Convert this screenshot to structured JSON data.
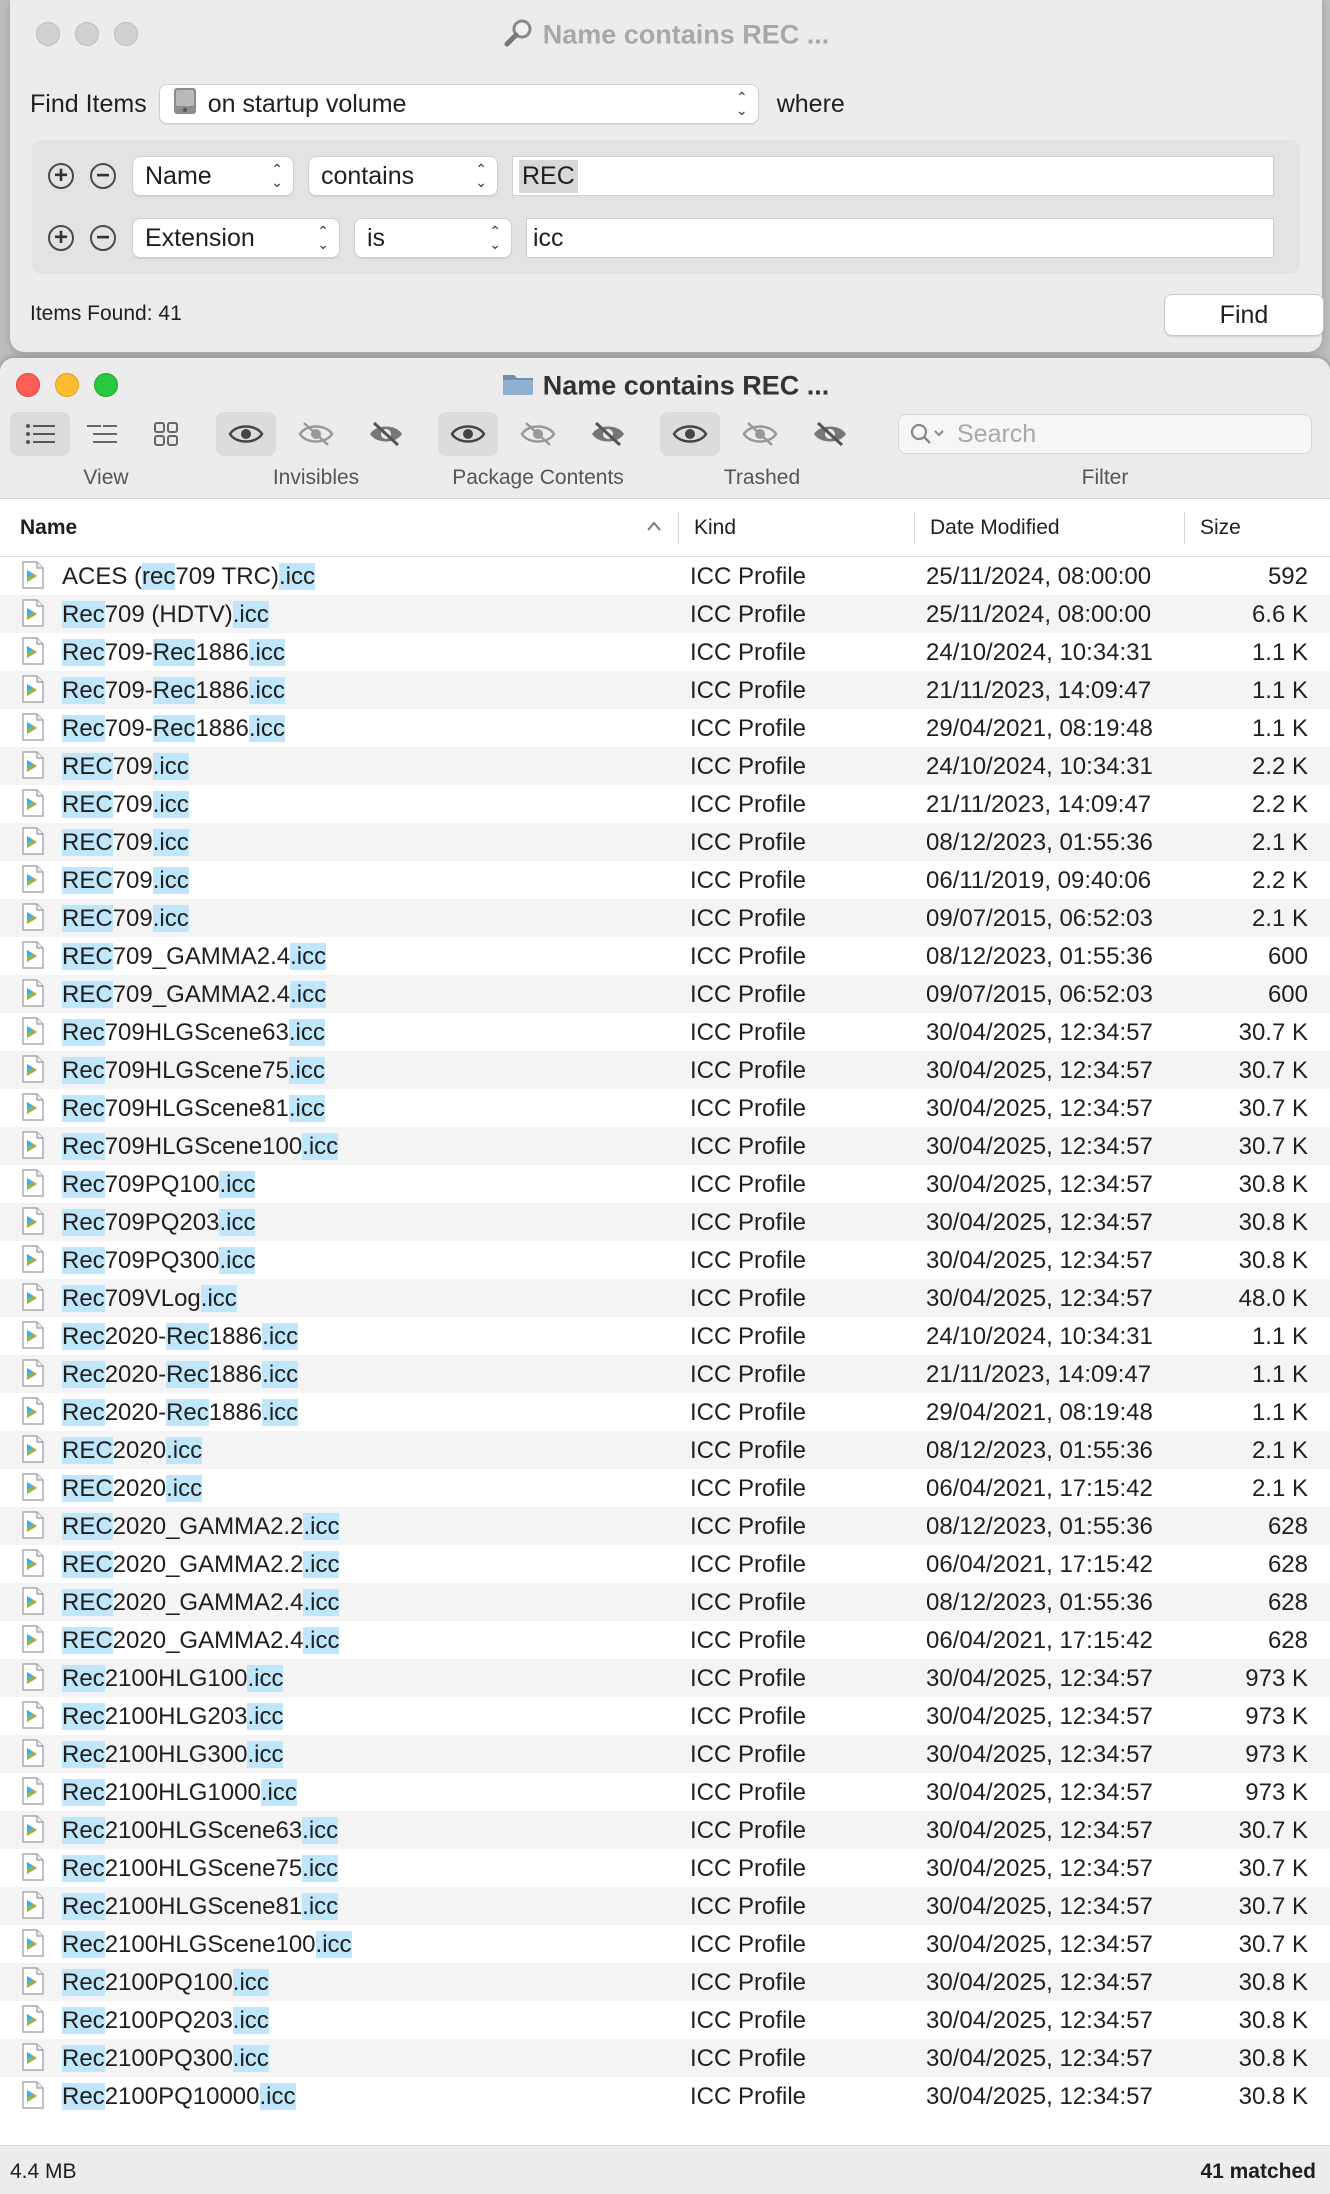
{
  "find_window": {
    "title": "Name contains REC ...",
    "find_items_label": "Find Items",
    "location": "on startup volume",
    "where_label": "where",
    "rules": [
      {
        "attribute": "Name",
        "operator": "contains",
        "value": "REC"
      },
      {
        "attribute": "Extension",
        "operator": "is",
        "value": "icc"
      }
    ],
    "items_found": "Items Found: 41",
    "find_button": "Find"
  },
  "results_window": {
    "title": "Name contains REC ...",
    "toolbar": {
      "view_label": "View",
      "invisibles_label": "Invisibles",
      "package_contents_label": "Package Contents",
      "trashed_label": "Trashed",
      "filter_label": "Filter",
      "search_placeholder": "Search"
    },
    "columns": {
      "name": "Name",
      "kind": "Kind",
      "date": "Date Modified",
      "size": "Size"
    },
    "rows": [
      {
        "name": "ACES (rec709 TRC).icc",
        "kind": "ICC Profile",
        "date": "25/11/2024, 08:00:00",
        "size": "592"
      },
      {
        "name": "Rec709 (HDTV).icc",
        "kind": "ICC Profile",
        "date": "25/11/2024, 08:00:00",
        "size": "6.6 K"
      },
      {
        "name": "Rec709-Rec1886.icc",
        "kind": "ICC Profile",
        "date": "24/10/2024, 10:34:31",
        "size": "1.1 K"
      },
      {
        "name": "Rec709-Rec1886.icc",
        "kind": "ICC Profile",
        "date": "21/11/2023, 14:09:47",
        "size": "1.1 K"
      },
      {
        "name": "Rec709-Rec1886.icc",
        "kind": "ICC Profile",
        "date": "29/04/2021, 08:19:48",
        "size": "1.1 K"
      },
      {
        "name": "REC709.icc",
        "kind": "ICC Profile",
        "date": "24/10/2024, 10:34:31",
        "size": "2.2 K"
      },
      {
        "name": "REC709.icc",
        "kind": "ICC Profile",
        "date": "21/11/2023, 14:09:47",
        "size": "2.2 K"
      },
      {
        "name": "REC709.icc",
        "kind": "ICC Profile",
        "date": "08/12/2023, 01:55:36",
        "size": "2.1 K"
      },
      {
        "name": "REC709.icc",
        "kind": "ICC Profile",
        "date": "06/11/2019, 09:40:06",
        "size": "2.2 K"
      },
      {
        "name": "REC709.icc",
        "kind": "ICC Profile",
        "date": "09/07/2015, 06:52:03",
        "size": "2.1 K"
      },
      {
        "name": "REC709_GAMMA2.4.icc",
        "kind": "ICC Profile",
        "date": "08/12/2023, 01:55:36",
        "size": "600"
      },
      {
        "name": "REC709_GAMMA2.4.icc",
        "kind": "ICC Profile",
        "date": "09/07/2015, 06:52:03",
        "size": "600"
      },
      {
        "name": "Rec709HLGScene63.icc",
        "kind": "ICC Profile",
        "date": "30/04/2025, 12:34:57",
        "size": "30.7 K"
      },
      {
        "name": "Rec709HLGScene75.icc",
        "kind": "ICC Profile",
        "date": "30/04/2025, 12:34:57",
        "size": "30.7 K"
      },
      {
        "name": "Rec709HLGScene81.icc",
        "kind": "ICC Profile",
        "date": "30/04/2025, 12:34:57",
        "size": "30.7 K"
      },
      {
        "name": "Rec709HLGScene100.icc",
        "kind": "ICC Profile",
        "date": "30/04/2025, 12:34:57",
        "size": "30.7 K"
      },
      {
        "name": "Rec709PQ100.icc",
        "kind": "ICC Profile",
        "date": "30/04/2025, 12:34:57",
        "size": "30.8 K"
      },
      {
        "name": "Rec709PQ203.icc",
        "kind": "ICC Profile",
        "date": "30/04/2025, 12:34:57",
        "size": "30.8 K"
      },
      {
        "name": "Rec709PQ300.icc",
        "kind": "ICC Profile",
        "date": "30/04/2025, 12:34:57",
        "size": "30.8 K"
      },
      {
        "name": "Rec709VLog.icc",
        "kind": "ICC Profile",
        "date": "30/04/2025, 12:34:57",
        "size": "48.0 K"
      },
      {
        "name": "Rec2020-Rec1886.icc",
        "kind": "ICC Profile",
        "date": "24/10/2024, 10:34:31",
        "size": "1.1 K"
      },
      {
        "name": "Rec2020-Rec1886.icc",
        "kind": "ICC Profile",
        "date": "21/11/2023, 14:09:47",
        "size": "1.1 K"
      },
      {
        "name": "Rec2020-Rec1886.icc",
        "kind": "ICC Profile",
        "date": "29/04/2021, 08:19:48",
        "size": "1.1 K"
      },
      {
        "name": "REC2020.icc",
        "kind": "ICC Profile",
        "date": "08/12/2023, 01:55:36",
        "size": "2.1 K"
      },
      {
        "name": "REC2020.icc",
        "kind": "ICC Profile",
        "date": "06/04/2021, 17:15:42",
        "size": "2.1 K"
      },
      {
        "name": "REC2020_GAMMA2.2.icc",
        "kind": "ICC Profile",
        "date": "08/12/2023, 01:55:36",
        "size": "628"
      },
      {
        "name": "REC2020_GAMMA2.2.icc",
        "kind": "ICC Profile",
        "date": "06/04/2021, 17:15:42",
        "size": "628"
      },
      {
        "name": "REC2020_GAMMA2.4.icc",
        "kind": "ICC Profile",
        "date": "08/12/2023, 01:55:36",
        "size": "628"
      },
      {
        "name": "REC2020_GAMMA2.4.icc",
        "kind": "ICC Profile",
        "date": "06/04/2021, 17:15:42",
        "size": "628"
      },
      {
        "name": "Rec2100HLG100.icc",
        "kind": "ICC Profile",
        "date": "30/04/2025, 12:34:57",
        "size": "973 K"
      },
      {
        "name": "Rec2100HLG203.icc",
        "kind": "ICC Profile",
        "date": "30/04/2025, 12:34:57",
        "size": "973 K"
      },
      {
        "name": "Rec2100HLG300.icc",
        "kind": "ICC Profile",
        "date": "30/04/2025, 12:34:57",
        "size": "973 K"
      },
      {
        "name": "Rec2100HLG1000.icc",
        "kind": "ICC Profile",
        "date": "30/04/2025, 12:34:57",
        "size": "973 K"
      },
      {
        "name": "Rec2100HLGScene63.icc",
        "kind": "ICC Profile",
        "date": "30/04/2025, 12:34:57",
        "size": "30.7 K"
      },
      {
        "name": "Rec2100HLGScene75.icc",
        "kind": "ICC Profile",
        "date": "30/04/2025, 12:34:57",
        "size": "30.7 K"
      },
      {
        "name": "Rec2100HLGScene81.icc",
        "kind": "ICC Profile",
        "date": "30/04/2025, 12:34:57",
        "size": "30.7 K"
      },
      {
        "name": "Rec2100HLGScene100.icc",
        "kind": "ICC Profile",
        "date": "30/04/2025, 12:34:57",
        "size": "30.7 K"
      },
      {
        "name": "Rec2100PQ100.icc",
        "kind": "ICC Profile",
        "date": "30/04/2025, 12:34:57",
        "size": "30.8 K"
      },
      {
        "name": "Rec2100PQ203.icc",
        "kind": "ICC Profile",
        "date": "30/04/2025, 12:34:57",
        "size": "30.8 K"
      },
      {
        "name": "Rec2100PQ300.icc",
        "kind": "ICC Profile",
        "date": "30/04/2025, 12:34:57",
        "size": "30.8 K"
      },
      {
        "name": "Rec2100PQ10000.icc",
        "kind": "ICC Profile",
        "date": "30/04/2025, 12:34:57",
        "size": "30.8 K"
      }
    ],
    "status_left": "4.4 MB",
    "status_right": "41 matched",
    "highlight_color": "#bfe6fb"
  }
}
